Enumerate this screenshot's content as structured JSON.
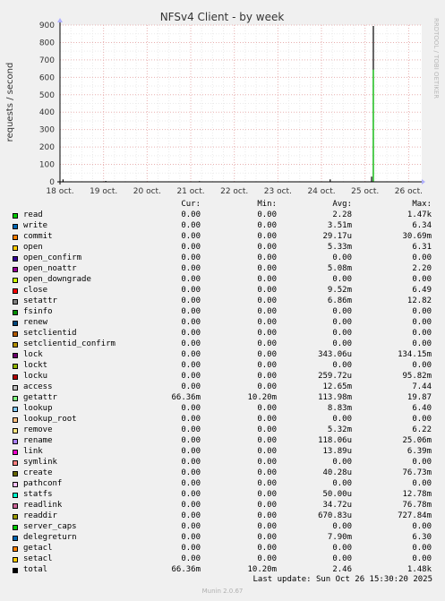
{
  "chart_data": {
    "type": "line",
    "title": "NFSv4 Client - by week",
    "ylabel": "requests / second",
    "watermark": "RRDTOOL / TOBI OETIKER",
    "ylim": [
      0,
      900
    ],
    "yticks": [
      "0",
      "100",
      "200",
      "300",
      "400",
      "500",
      "600",
      "700",
      "800",
      "900"
    ],
    "x_labels": [
      "18 oct.",
      "19 oct.",
      "20 oct.",
      "21 oct.",
      "22 oct.",
      "23 oct.",
      "24 oct.",
      "25 oct.",
      "26 oct."
    ],
    "grid": true,
    "spikes": [
      {
        "day": 0.07,
        "value": 14
      },
      {
        "day": 1.05,
        "value": 5
      },
      {
        "day": 3.2,
        "value": 4
      },
      {
        "day": 6.2,
        "value": 14
      },
      {
        "day": 7.15,
        "value": 30
      },
      {
        "day": 7.19,
        "value": 895
      }
    ]
  },
  "legend": {
    "headers": {
      "cur": "Cur:",
      "min": "Min:",
      "avg": "Avg:",
      "max": "Max:"
    },
    "rows": [
      {
        "name": "read",
        "color": "#00cc00",
        "cur": "0.00",
        "min": "0.00",
        "avg": "2.28",
        "max": "1.47k"
      },
      {
        "name": "write",
        "color": "#0066b3",
        "cur": "0.00",
        "min": "0.00",
        "avg": "3.51m",
        "max": "6.34"
      },
      {
        "name": "commit",
        "color": "#ff8000",
        "cur": "0.00",
        "min": "0.00",
        "avg": "29.17u",
        "max": "30.69m"
      },
      {
        "name": "open",
        "color": "#ffcc00",
        "cur": "0.00",
        "min": "0.00",
        "avg": "5.33m",
        "max": "6.31"
      },
      {
        "name": "open_confirm",
        "color": "#330099",
        "cur": "0.00",
        "min": "0.00",
        "avg": "0.00",
        "max": "0.00"
      },
      {
        "name": "open_noattr",
        "color": "#990099",
        "cur": "0.00",
        "min": "0.00",
        "avg": "5.08m",
        "max": "2.20"
      },
      {
        "name": "open_downgrade",
        "color": "#ccff00",
        "cur": "0.00",
        "min": "0.00",
        "avg": "0.00",
        "max": "0.00"
      },
      {
        "name": "close",
        "color": "#ff0000",
        "cur": "0.00",
        "min": "0.00",
        "avg": "9.52m",
        "max": "6.49"
      },
      {
        "name": "setattr",
        "color": "#808080",
        "cur": "0.00",
        "min": "0.00",
        "avg": "6.86m",
        "max": "12.82"
      },
      {
        "name": "fsinfo",
        "color": "#008f00",
        "cur": "0.00",
        "min": "0.00",
        "avg": "0.00",
        "max": "0.00"
      },
      {
        "name": "renew",
        "color": "#00487d",
        "cur": "0.00",
        "min": "0.00",
        "avg": "0.00",
        "max": "0.00"
      },
      {
        "name": "setclientid",
        "color": "#b35a00",
        "cur": "0.00",
        "min": "0.00",
        "avg": "0.00",
        "max": "0.00"
      },
      {
        "name": "setclientid_confirm",
        "color": "#b38f00",
        "cur": "0.00",
        "min": "0.00",
        "avg": "0.00",
        "max": "0.00"
      },
      {
        "name": "lock",
        "color": "#6b006b",
        "cur": "0.00",
        "min": "0.00",
        "avg": "343.06u",
        "max": "134.15m"
      },
      {
        "name": "lockt",
        "color": "#8fb300",
        "cur": "0.00",
        "min": "0.00",
        "avg": "0.00",
        "max": "0.00"
      },
      {
        "name": "locku",
        "color": "#b30000",
        "cur": "0.00",
        "min": "0.00",
        "avg": "259.72u",
        "max": "95.82m"
      },
      {
        "name": "access",
        "color": "#bebebe",
        "cur": "0.00",
        "min": "0.00",
        "avg": "12.65m",
        "max": "7.44"
      },
      {
        "name": "getattr",
        "color": "#80ff80",
        "cur": "66.36m",
        "min": "10.20m",
        "avg": "113.98m",
        "max": "19.87"
      },
      {
        "name": "lookup",
        "color": "#80c9ff",
        "cur": "0.00",
        "min": "0.00",
        "avg": "8.83m",
        "max": "6.40"
      },
      {
        "name": "lookup_root",
        "color": "#ffc080",
        "cur": "0.00",
        "min": "0.00",
        "avg": "0.00",
        "max": "0.00"
      },
      {
        "name": "remove",
        "color": "#ffe680",
        "cur": "0.00",
        "min": "0.00",
        "avg": "5.32m",
        "max": "6.22"
      },
      {
        "name": "rename",
        "color": "#aa80ff",
        "cur": "0.00",
        "min": "0.00",
        "avg": "118.06u",
        "max": "25.06m"
      },
      {
        "name": "link",
        "color": "#ee00cc",
        "cur": "0.00",
        "min": "0.00",
        "avg": "13.89u",
        "max": "6.39m"
      },
      {
        "name": "symlink",
        "color": "#ff8080",
        "cur": "0.00",
        "min": "0.00",
        "avg": "0.00",
        "max": "0.00"
      },
      {
        "name": "create",
        "color": "#666600",
        "cur": "0.00",
        "min": "0.00",
        "avg": "40.28u",
        "max": "76.73m"
      },
      {
        "name": "pathconf",
        "color": "#ffbfff",
        "cur": "0.00",
        "min": "0.00",
        "avg": "0.00",
        "max": "0.00"
      },
      {
        "name": "statfs",
        "color": "#00ffcc",
        "cur": "0.00",
        "min": "0.00",
        "avg": "50.00u",
        "max": "12.78m"
      },
      {
        "name": "readlink",
        "color": "#cc6699",
        "cur": "0.00",
        "min": "0.00",
        "avg": "34.72u",
        "max": "76.78m"
      },
      {
        "name": "readdir",
        "color": "#999900",
        "cur": "0.00",
        "min": "0.00",
        "avg": "670.83u",
        "max": "727.84m"
      },
      {
        "name": "server_caps",
        "color": "#00cc00",
        "cur": "0.00",
        "min": "0.00",
        "avg": "0.00",
        "max": "0.00"
      },
      {
        "name": "delegreturn",
        "color": "#0066b3",
        "cur": "0.00",
        "min": "0.00",
        "avg": "7.90m",
        "max": "6.30"
      },
      {
        "name": "getacl",
        "color": "#ff8000",
        "cur": "0.00",
        "min": "0.00",
        "avg": "0.00",
        "max": "0.00"
      },
      {
        "name": "setacl",
        "color": "#ffcc00",
        "cur": "0.00",
        "min": "0.00",
        "avg": "0.00",
        "max": "0.00"
      },
      {
        "name": "total",
        "color": "#000000",
        "cur": "66.36m",
        "min": "10.20m",
        "avg": "2.46",
        "max": "1.48k"
      }
    ]
  },
  "footer": {
    "last_update": "Last update: Sun Oct 26 15:30:20 2025",
    "munin": "Munin 2.0.67"
  }
}
